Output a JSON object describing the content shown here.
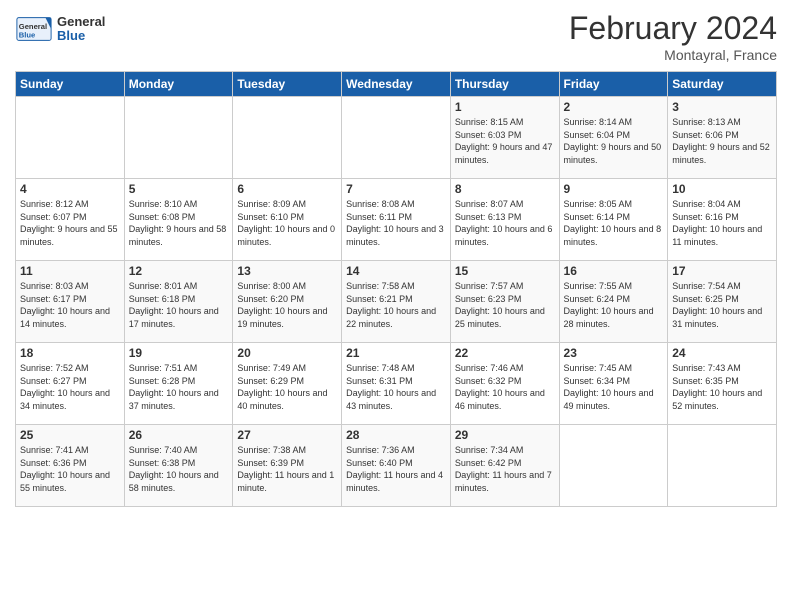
{
  "header": {
    "logo_general": "General",
    "logo_blue": "Blue",
    "month_title": "February 2024",
    "location": "Montayral, France"
  },
  "days_of_week": [
    "Sunday",
    "Monday",
    "Tuesday",
    "Wednesday",
    "Thursday",
    "Friday",
    "Saturday"
  ],
  "weeks": [
    [
      {
        "day": "",
        "info": ""
      },
      {
        "day": "",
        "info": ""
      },
      {
        "day": "",
        "info": ""
      },
      {
        "day": "",
        "info": ""
      },
      {
        "day": "1",
        "info": "Sunrise: 8:15 AM\nSunset: 6:03 PM\nDaylight: 9 hours and 47 minutes."
      },
      {
        "day": "2",
        "info": "Sunrise: 8:14 AM\nSunset: 6:04 PM\nDaylight: 9 hours and 50 minutes."
      },
      {
        "day": "3",
        "info": "Sunrise: 8:13 AM\nSunset: 6:06 PM\nDaylight: 9 hours and 52 minutes."
      }
    ],
    [
      {
        "day": "4",
        "info": "Sunrise: 8:12 AM\nSunset: 6:07 PM\nDaylight: 9 hours and 55 minutes."
      },
      {
        "day": "5",
        "info": "Sunrise: 8:10 AM\nSunset: 6:08 PM\nDaylight: 9 hours and 58 minutes."
      },
      {
        "day": "6",
        "info": "Sunrise: 8:09 AM\nSunset: 6:10 PM\nDaylight: 10 hours and 0 minutes."
      },
      {
        "day": "7",
        "info": "Sunrise: 8:08 AM\nSunset: 6:11 PM\nDaylight: 10 hours and 3 minutes."
      },
      {
        "day": "8",
        "info": "Sunrise: 8:07 AM\nSunset: 6:13 PM\nDaylight: 10 hours and 6 minutes."
      },
      {
        "day": "9",
        "info": "Sunrise: 8:05 AM\nSunset: 6:14 PM\nDaylight: 10 hours and 8 minutes."
      },
      {
        "day": "10",
        "info": "Sunrise: 8:04 AM\nSunset: 6:16 PM\nDaylight: 10 hours and 11 minutes."
      }
    ],
    [
      {
        "day": "11",
        "info": "Sunrise: 8:03 AM\nSunset: 6:17 PM\nDaylight: 10 hours and 14 minutes."
      },
      {
        "day": "12",
        "info": "Sunrise: 8:01 AM\nSunset: 6:18 PM\nDaylight: 10 hours and 17 minutes."
      },
      {
        "day": "13",
        "info": "Sunrise: 8:00 AM\nSunset: 6:20 PM\nDaylight: 10 hours and 19 minutes."
      },
      {
        "day": "14",
        "info": "Sunrise: 7:58 AM\nSunset: 6:21 PM\nDaylight: 10 hours and 22 minutes."
      },
      {
        "day": "15",
        "info": "Sunrise: 7:57 AM\nSunset: 6:23 PM\nDaylight: 10 hours and 25 minutes."
      },
      {
        "day": "16",
        "info": "Sunrise: 7:55 AM\nSunset: 6:24 PM\nDaylight: 10 hours and 28 minutes."
      },
      {
        "day": "17",
        "info": "Sunrise: 7:54 AM\nSunset: 6:25 PM\nDaylight: 10 hours and 31 minutes."
      }
    ],
    [
      {
        "day": "18",
        "info": "Sunrise: 7:52 AM\nSunset: 6:27 PM\nDaylight: 10 hours and 34 minutes."
      },
      {
        "day": "19",
        "info": "Sunrise: 7:51 AM\nSunset: 6:28 PM\nDaylight: 10 hours and 37 minutes."
      },
      {
        "day": "20",
        "info": "Sunrise: 7:49 AM\nSunset: 6:29 PM\nDaylight: 10 hours and 40 minutes."
      },
      {
        "day": "21",
        "info": "Sunrise: 7:48 AM\nSunset: 6:31 PM\nDaylight: 10 hours and 43 minutes."
      },
      {
        "day": "22",
        "info": "Sunrise: 7:46 AM\nSunset: 6:32 PM\nDaylight: 10 hours and 46 minutes."
      },
      {
        "day": "23",
        "info": "Sunrise: 7:45 AM\nSunset: 6:34 PM\nDaylight: 10 hours and 49 minutes."
      },
      {
        "day": "24",
        "info": "Sunrise: 7:43 AM\nSunset: 6:35 PM\nDaylight: 10 hours and 52 minutes."
      }
    ],
    [
      {
        "day": "25",
        "info": "Sunrise: 7:41 AM\nSunset: 6:36 PM\nDaylight: 10 hours and 55 minutes."
      },
      {
        "day": "26",
        "info": "Sunrise: 7:40 AM\nSunset: 6:38 PM\nDaylight: 10 hours and 58 minutes."
      },
      {
        "day": "27",
        "info": "Sunrise: 7:38 AM\nSunset: 6:39 PM\nDaylight: 11 hours and 1 minute."
      },
      {
        "day": "28",
        "info": "Sunrise: 7:36 AM\nSunset: 6:40 PM\nDaylight: 11 hours and 4 minutes."
      },
      {
        "day": "29",
        "info": "Sunrise: 7:34 AM\nSunset: 6:42 PM\nDaylight: 11 hours and 7 minutes."
      },
      {
        "day": "",
        "info": ""
      },
      {
        "day": "",
        "info": ""
      }
    ]
  ]
}
